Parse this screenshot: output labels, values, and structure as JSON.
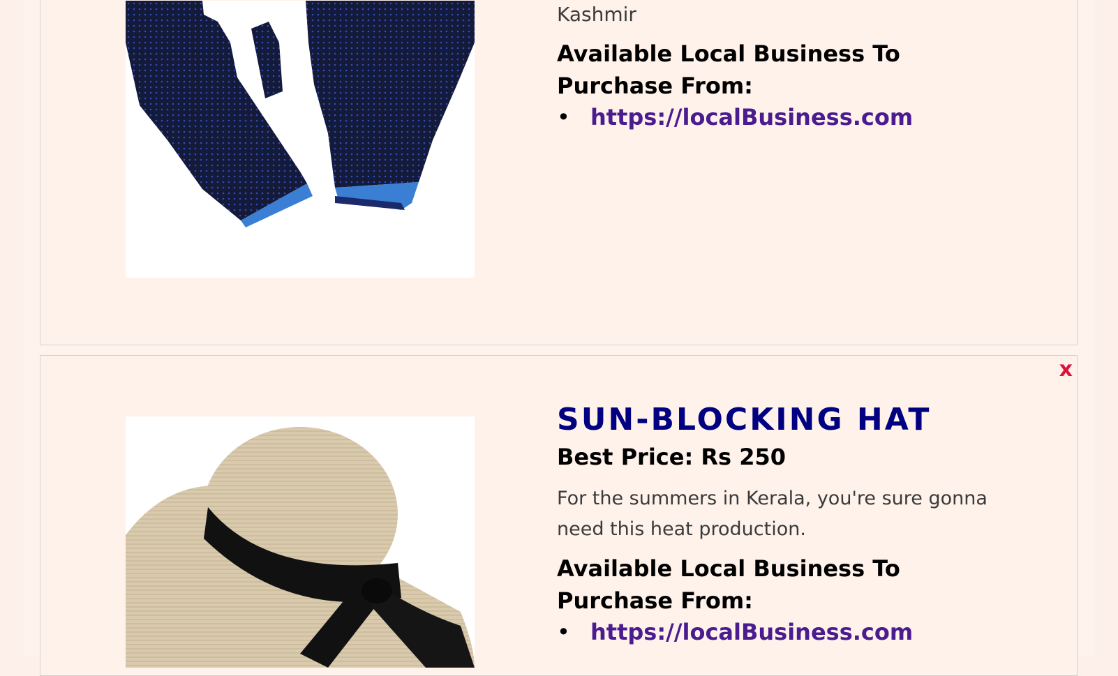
{
  "products": [
    {
      "origin": "Kashmir",
      "image_icon": "gloves-image",
      "availability_heading": "Available Local Business To Purchase From:",
      "shops": [
        "https://localBusiness.com"
      ]
    },
    {
      "title": "SUN-BLOCKING HAT",
      "price": "Best Price: Rs 250",
      "description": "For the summers in Kerala, you're sure gonna need this heat production.",
      "image_icon": "straw-hat-image",
      "availability_heading": "Available Local Business To Purchase From:",
      "shops": [
        "https://localBusiness.com"
      ],
      "close_label": "x"
    }
  ],
  "colors": {
    "page_background": "#fef3ed",
    "title": "#000080",
    "link": "#4b1c8f",
    "close": "#dc143c"
  }
}
